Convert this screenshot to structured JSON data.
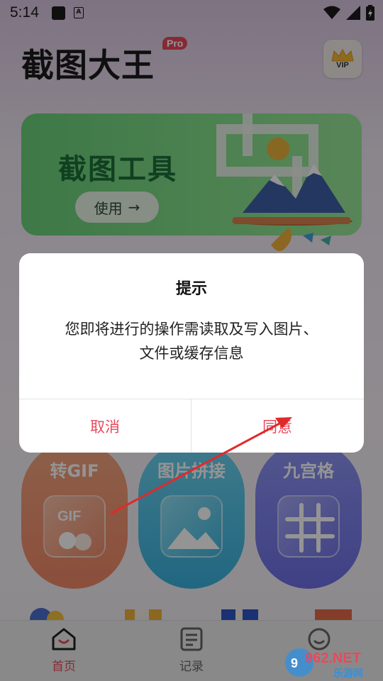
{
  "status_bar": {
    "time": "5:14",
    "icons": [
      "notification-square-icon",
      "a-notification-icon",
      "wifi-icon",
      "signal-icon",
      "battery-icon"
    ]
  },
  "header": {
    "app_title": "截图大王",
    "pro_badge": "Pro",
    "vip_label": "VIP"
  },
  "banner": {
    "title": "截图工具",
    "button_label": "使用",
    "button_icon": "arrow-right-icon"
  },
  "features": [
    {
      "label": "转GIF",
      "icon": "gif-icon"
    },
    {
      "label": "图片拼接",
      "icon": "image-icon"
    },
    {
      "label": "九宫格",
      "icon": "grid-icon"
    }
  ],
  "bottom_nav": {
    "items": [
      {
        "label": "首页",
        "icon": "home-icon",
        "active": true
      },
      {
        "label": "记录",
        "icon": "document-icon",
        "active": false
      },
      {
        "label": "",
        "icon": "profile-icon",
        "active": false
      }
    ]
  },
  "dialog": {
    "title": "提示",
    "message_line1": "您即将进行的操作需读取及写入图片、",
    "message_line2": "文件或缓存信息",
    "cancel_label": "取消",
    "confirm_label": "同意"
  },
  "watermark": {
    "top": "962.NET",
    "bottom": "乐游网"
  },
  "colors": {
    "accent": "#e8495c",
    "banner_green": "#6ad07a",
    "nav_active": "#e8495c",
    "nav_inactive": "#666666"
  }
}
